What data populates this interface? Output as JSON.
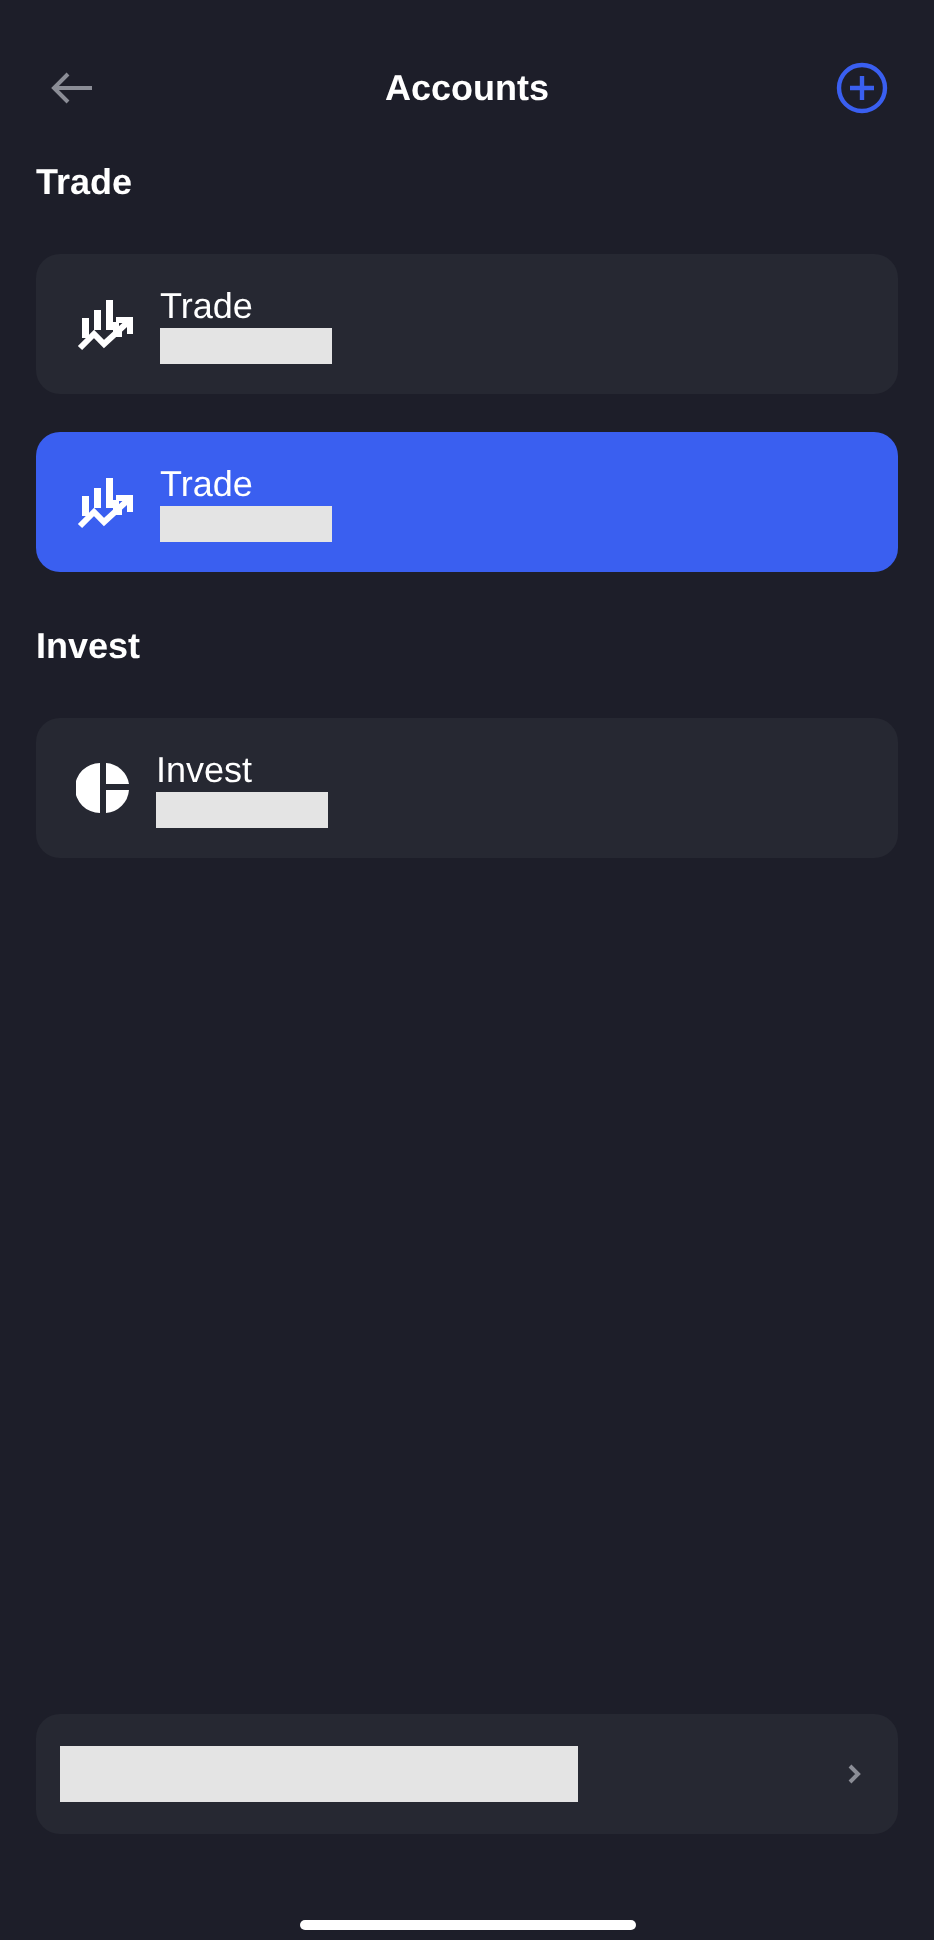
{
  "header": {
    "title": "Accounts"
  },
  "sections": [
    {
      "title": "Trade",
      "accounts": [
        {
          "name": "Trade",
          "kind": "trade",
          "selected": false
        },
        {
          "name": "Trade",
          "kind": "trade",
          "selected": true
        }
      ]
    },
    {
      "title": "Invest",
      "accounts": [
        {
          "name": "Invest",
          "kind": "invest",
          "selected": false
        }
      ]
    }
  ]
}
